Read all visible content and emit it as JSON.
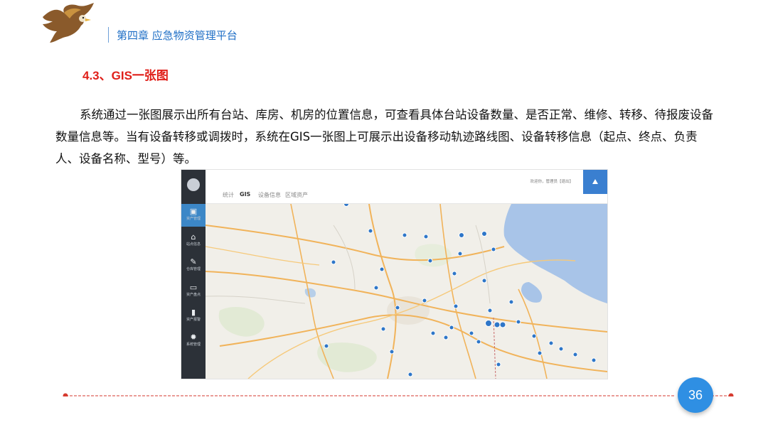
{
  "header": {
    "chapter": "第四章 应急物资管理平台"
  },
  "section": {
    "title": "4.3、GIS一张图"
  },
  "body": {
    "paragraph": "系统通过一张图展示出所有台站、库房、机房的位置信息，可查看具体台站设备数量、是否正常、维修、转移、待报废设备数量信息等。当有设备转移或调拨时，系统在GIS一张图上可展示出设备移动轨迹路线图、设备转移信息（起点、终点、负责人、设备名称、型号）等。"
  },
  "screenshot": {
    "tabs": [
      {
        "label": "统计",
        "active": false
      },
      {
        "label": "GIS",
        "active": true
      },
      {
        "label": "设备信息",
        "active": false
      },
      {
        "label": "区域资产",
        "active": false
      }
    ],
    "welcome": "欢迎你，管理员【退出】",
    "sidebar": [
      {
        "label": "资产管理",
        "icon": "calendar-icon",
        "active": true
      },
      {
        "label": "站点信息",
        "icon": "home-icon",
        "active": false
      },
      {
        "label": "仓库管理",
        "icon": "edit-icon",
        "active": false
      },
      {
        "label": "资产盘点",
        "icon": "monitor-icon",
        "active": false
      },
      {
        "label": "资产报警",
        "icon": "phone-icon",
        "active": false
      },
      {
        "label": "系统管理",
        "icon": "gear-icon",
        "active": false
      }
    ],
    "colors": {
      "sidebar": "#2c3138",
      "accent": "#3c87c7",
      "water": "#a8c4e8",
      "land": "#f1efe9"
    }
  },
  "footer": {
    "page_number": "36",
    "line_color": "#d63a2f",
    "badge_color": "#2f8fe3"
  }
}
